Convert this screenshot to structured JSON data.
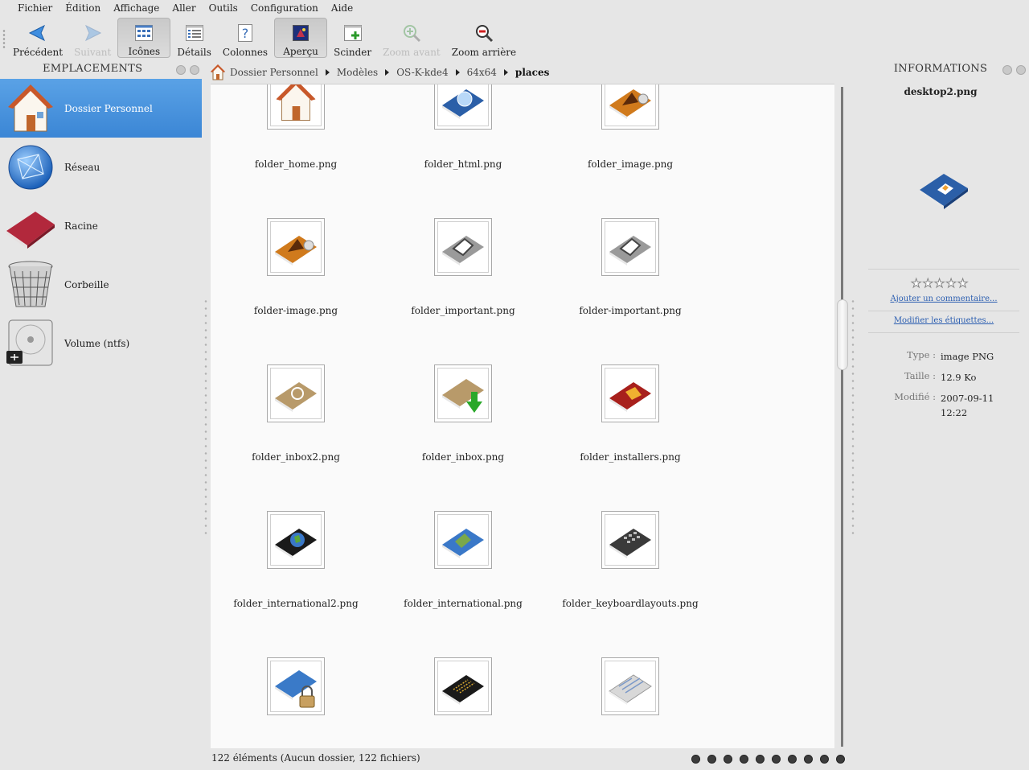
{
  "menubar": [
    "Fichier",
    "Édition",
    "Affichage",
    "Aller",
    "Outils",
    "Configuration",
    "Aide"
  ],
  "toolbar": {
    "back": "Précédent",
    "forward": "Suivant",
    "icons": "Icônes",
    "details": "Détails",
    "columns": "Colonnes",
    "preview": "Aperçu",
    "split": "Scinder",
    "zoom_in": "Zoom avant",
    "zoom_out": "Zoom arrière"
  },
  "places_panel": {
    "title": "EMPLACEMENTS",
    "items": [
      "Dossier Personnel",
      "Réseau",
      "Racine",
      "Corbeille",
      "Volume (ntfs)"
    ]
  },
  "breadcrumb": [
    "Dossier Personnel",
    "Modèles",
    "OS-K-kde4",
    "64x64",
    "places"
  ],
  "files": [
    {
      "name": "folder_home.png",
      "icon": "house-folder-icon"
    },
    {
      "name": "folder_html.png",
      "icon": "html-folder-icon"
    },
    {
      "name": "folder_image.png",
      "icon": "image-folder-icon"
    },
    {
      "name": "folder-image.png",
      "icon": "image-folder-icon"
    },
    {
      "name": "folder_important.png",
      "icon": "important-folder-icon"
    },
    {
      "name": "folder-important.png",
      "icon": "important-folder-icon"
    },
    {
      "name": "folder_inbox2.png",
      "icon": "inbox-folder-icon"
    },
    {
      "name": "folder_inbox.png",
      "icon": "inbox-download-folder-icon"
    },
    {
      "name": "folder_installers.png",
      "icon": "installers-folder-icon"
    },
    {
      "name": "folder_international2.png",
      "icon": "globe-folder-icon"
    },
    {
      "name": "folder_international.png",
      "icon": "globe-folder-icon"
    },
    {
      "name": "folder_keyboardlayouts.png",
      "icon": "keyboard-folder-icon"
    },
    {
      "name": "",
      "icon": "locked-folder-icon"
    },
    {
      "name": "",
      "icon": "matrix-folder-icon"
    },
    {
      "name": "",
      "icon": "mail-folder-icon"
    }
  ],
  "status": "122 éléments (Aucun dossier, 122 fichiers)",
  "info": {
    "title": "INFORMATIONS",
    "filename": "desktop2.png",
    "add_comment": "Ajouter un commentaire...",
    "edit_tags": "Modifier les étiquettes...",
    "type_label": "Type :",
    "type_value": "image PNG",
    "size_label": "Taille :",
    "size_value": "12.9 Ko",
    "modified_label": "Modifié :",
    "modified_value": "2007-09-11 12:22",
    "rating_stars": 0
  },
  "colors": {
    "selection": "#3b86d5",
    "link": "#2a5db0"
  }
}
